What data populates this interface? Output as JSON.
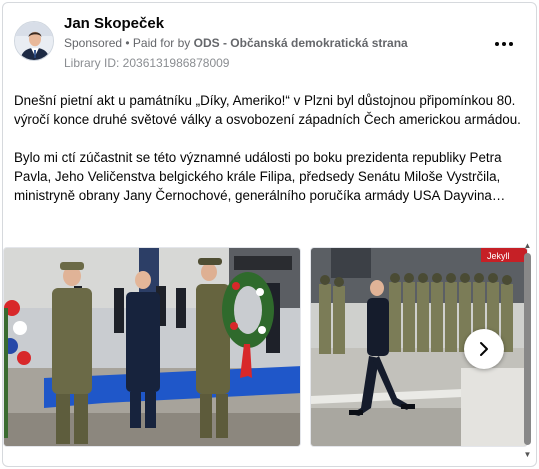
{
  "post": {
    "author": "Jan Skopeček",
    "sponsored": "Sponsored",
    "separator": " • ",
    "paid_for_prefix": "Paid for by ",
    "advertiser": "ODS - Občanská demokratická strana",
    "library_id": "Library ID: 2036131986878009",
    "paragraphs": [
      "Dnešní pietní akt u památníku „Díky, Ameriko!“ v Plzni byl důstojnou připomínkou 80. výročí konce druhé světové války a osvobození západních Čech americkou armádou.",
      "Bylo mi ctí zúčastnit se této významné události po boku prezidenta republiky Petra Pavla, Jeho Veličenstva belgického krále Filipa, předsedy Senátu Miloše Vystrčila, ministryně obrany Jany Černochové, generálního poručíka armády USA Dayvina…"
    ]
  },
  "carousel": {
    "photo2_sign": "Jekyll",
    "next_icon": "chevron-right-icon"
  },
  "colors": {
    "text": "#050505",
    "meta": "#65676b",
    "carpet": "#1f57c9",
    "uniform": "#6b6a47"
  }
}
